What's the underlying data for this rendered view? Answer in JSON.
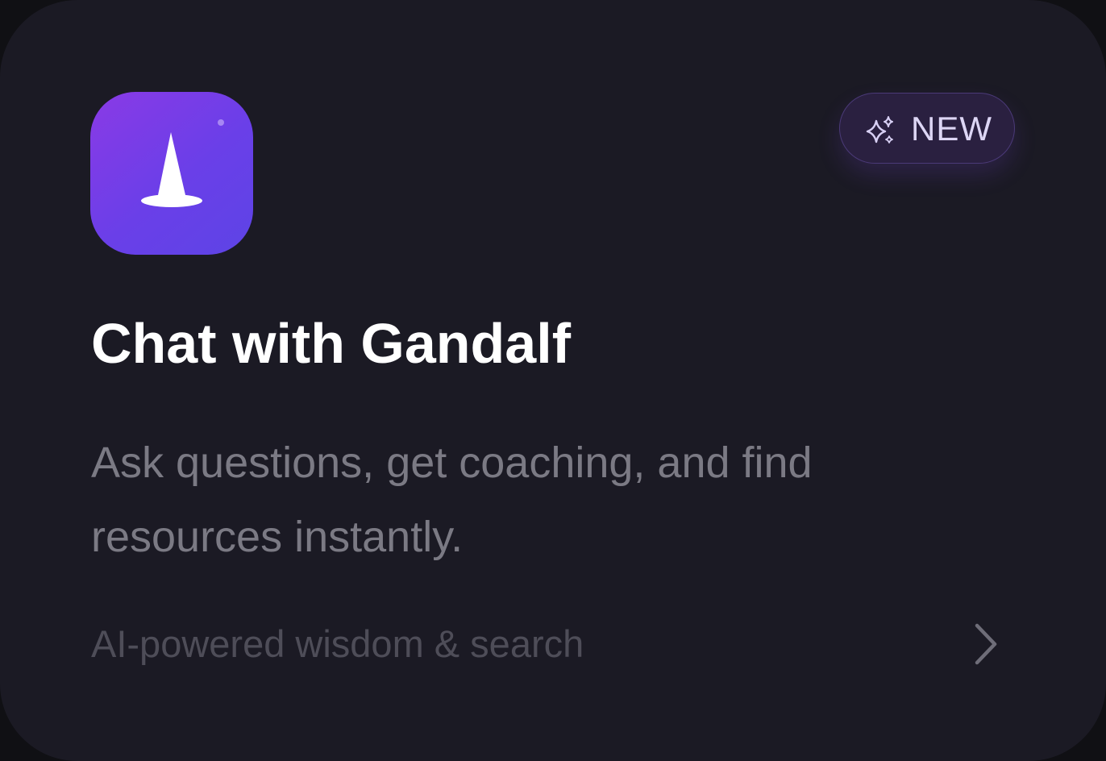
{
  "card": {
    "icon": "wizard-hat-icon",
    "badge": {
      "icon": "sparkles-icon",
      "label": "NEW"
    },
    "title": "Chat with Gandalf",
    "description": "Ask questions, get coaching, and find resources instantly.",
    "footer": "AI-powered wisdom & search",
    "action_icon": "chevron-right-icon"
  },
  "colors": {
    "card_background": "#1b1a24",
    "icon_gradient_start": "#8a3ae6",
    "icon_gradient_end": "#5d44e6",
    "badge_background": "#2a2040",
    "badge_border": "#4b3a78",
    "title_text": "#ffffff",
    "description_text": "#7b7a84",
    "footer_text": "#4e4d58"
  }
}
